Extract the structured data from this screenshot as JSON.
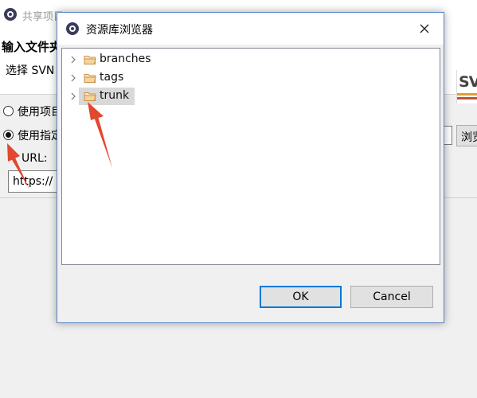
{
  "background_window": {
    "title": "共享项目",
    "header_title": "输入文件夹",
    "header_subtitle": "选择 SVN",
    "logo_text": "SV",
    "option_project_label": "使用项目",
    "option_specified_label": "使用指定",
    "url_label": "URL:",
    "url_value": "https://",
    "browse_label": "浏览"
  },
  "dialog": {
    "title": "资源库浏览器",
    "close_icon": "close-icon",
    "tree": [
      {
        "label": "branches",
        "icon": "folder-icon",
        "selected": false
      },
      {
        "label": "tags",
        "icon": "folder-icon",
        "selected": false
      },
      {
        "label": "trunk",
        "icon": "folder-icon",
        "selected": true
      }
    ],
    "ok_label": "OK",
    "cancel_label": "Cancel"
  },
  "colors": {
    "annotation_arrow": "#e2472f",
    "default_button_border": "#0078d7",
    "folder": "#c8904a",
    "selection": "#d9d9d9"
  }
}
